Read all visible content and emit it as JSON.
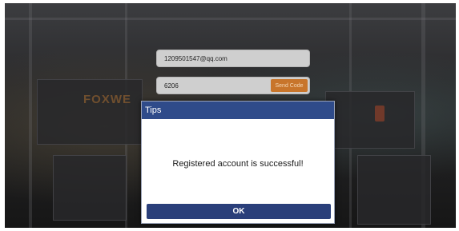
{
  "form": {
    "email_value": "1209501547@qq.com",
    "code_value": "6206",
    "send_code_label": "Send Code"
  },
  "background": {
    "logo_text": "FOXWE"
  },
  "dialog": {
    "title": "Tips",
    "message": "Registered account is successful!",
    "ok_label": "OK"
  },
  "colors": {
    "dialog_title_bar": "#2f4b8a",
    "ok_button": "#2a3f7a",
    "send_code_button": "#c8752b"
  }
}
